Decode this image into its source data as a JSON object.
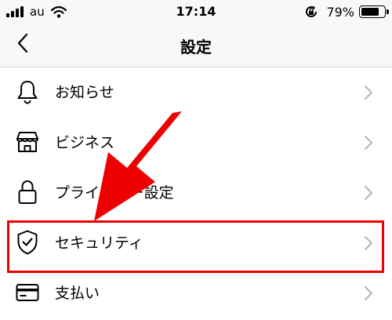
{
  "status_bar": {
    "carrier": "au",
    "time": "17:14",
    "battery_percent": "79%",
    "battery_level": 0.79,
    "signal_bars": 4
  },
  "nav": {
    "back_icon": "chevron-left-icon",
    "title": "設定"
  },
  "menu_items": [
    {
      "label": "お知らせ",
      "icon": "bell-icon"
    },
    {
      "label": "ビジネス",
      "icon": "storefront-icon"
    },
    {
      "label": "プライバシー設定",
      "icon": "lock-icon"
    },
    {
      "label": "セキュリティ",
      "icon": "shield-check-icon",
      "highlighted": true
    },
    {
      "label": "支払い",
      "icon": "credit-card-icon"
    }
  ],
  "annotation": {
    "arrow_color": "#ee0000",
    "highlight_color": "#ee0000"
  }
}
